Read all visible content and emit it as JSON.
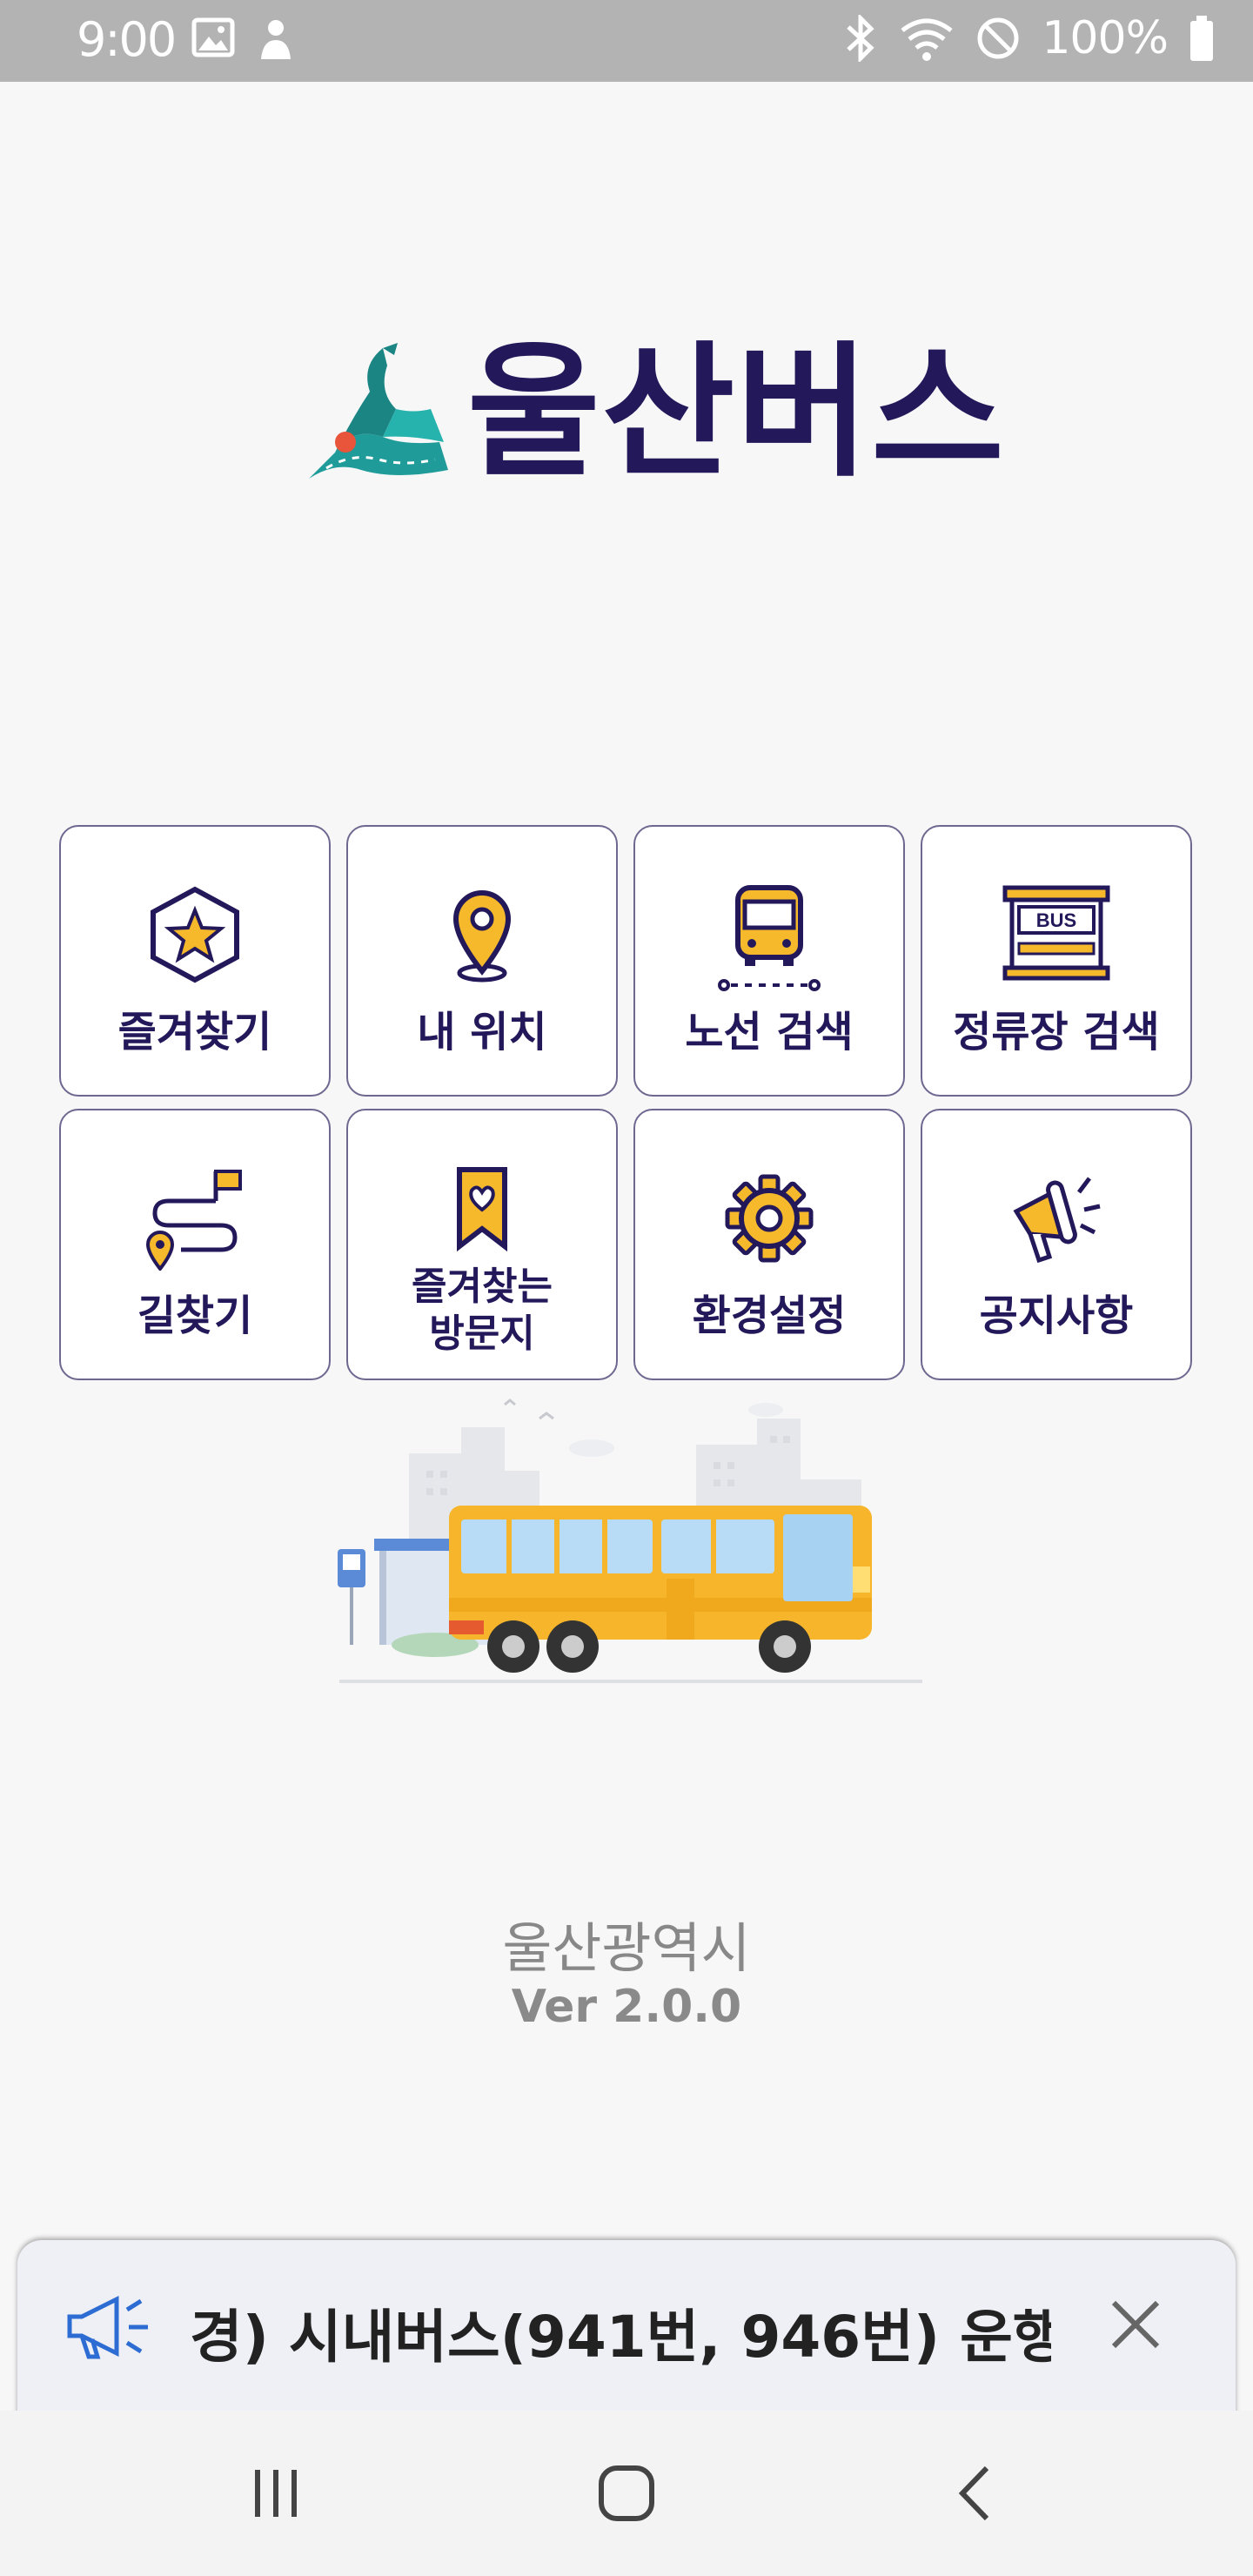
{
  "status_bar": {
    "time": "9:00",
    "left_icons": [
      "image-icon",
      "person-icon"
    ],
    "right_icons": [
      "bluetooth-icon",
      "wifi-icon",
      "dnd-icon",
      "battery-icon"
    ],
    "battery_text": "100%"
  },
  "app": {
    "title": "울산버스",
    "accent": "#23195a",
    "logo_colors": [
      "#1f9c9a",
      "#e8553b"
    ]
  },
  "menu": [
    {
      "label": "즐겨찾기",
      "icon": "star-badge-icon"
    },
    {
      "label": "내 위치",
      "icon": "location-pin-icon"
    },
    {
      "label": "노선 검색",
      "icon": "bus-route-icon"
    },
    {
      "label": "정류장 검색",
      "icon": "bus-stop-icon",
      "sign_text": "BUS"
    },
    {
      "label": "길찾기",
      "icon": "route-flag-icon"
    },
    {
      "label_line1": "즐겨찾는",
      "label_line2": "방문지",
      "icon": "bookmark-heart-icon"
    },
    {
      "label": "환경설정",
      "icon": "gear-icon"
    },
    {
      "label": "공지사항",
      "icon": "megaphone-icon"
    }
  ],
  "footer": {
    "organization": "울산광역시",
    "version": "Ver 2.0.0"
  },
  "notice": {
    "text": "경) 시내버스(941번, 946번) 운행",
    "icon": "megaphone-outline-icon",
    "close_icon": "close-icon"
  },
  "nav_bar": {
    "buttons": [
      "recents-icon",
      "home-icon",
      "back-icon"
    ]
  }
}
